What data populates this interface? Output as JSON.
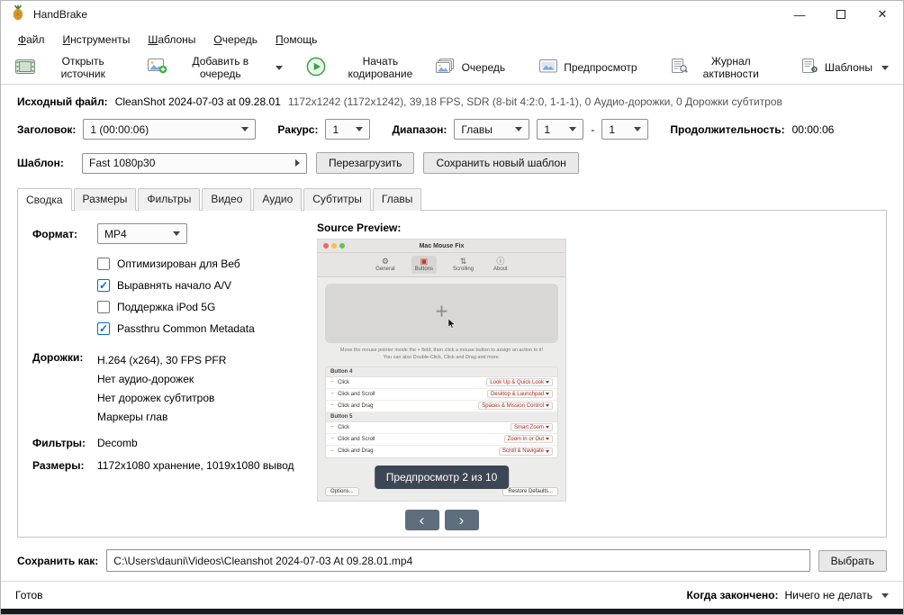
{
  "window": {
    "title": "HandBrake"
  },
  "menu": {
    "items": [
      {
        "label": "Файл"
      },
      {
        "label": "Инструменты"
      },
      {
        "label": "Шаблоны"
      },
      {
        "label": "Очередь"
      },
      {
        "label": "Помощь"
      }
    ]
  },
  "toolbar": {
    "open_source": "Открыть источник",
    "add_to_queue": "Добавить в очередь",
    "start_encoding": "Начать кодирование",
    "queue": "Очередь",
    "preview": "Предпросмотр",
    "activity_log": "Журнал активности",
    "presets": "Шаблоны"
  },
  "source": {
    "label": "Исходный файл:",
    "name": "CleanShot 2024-07-03 at 09.28.01",
    "details": "1172x1242 (1172x1242), 39,18 FPS, SDR (8-bit 4:2:0, 1-1-1), 0 Аудио-дорожки, 0 Дорожки субтитров"
  },
  "title_row": {
    "title_label": "Заголовок:",
    "title_value": "1 (00:00:06)",
    "angle_label": "Ракурс:",
    "angle_value": "1",
    "range_label": "Диапазон:",
    "range_value": "Главы",
    "range_from": "1",
    "range_sep": "-",
    "range_to": "1",
    "duration_label": "Продолжительность:",
    "duration_value": "00:00:06"
  },
  "preset_row": {
    "label": "Шаблон:",
    "value": "Fast 1080p30",
    "reload": "Перезагрузить",
    "save_new": "Сохранить новый шаблон"
  },
  "tabs": {
    "items": [
      {
        "label": "Сводка"
      },
      {
        "label": "Размеры"
      },
      {
        "label": "Фильтры"
      },
      {
        "label": "Видео"
      },
      {
        "label": "Аудио"
      },
      {
        "label": "Субтитры"
      },
      {
        "label": "Главы"
      }
    ]
  },
  "summary": {
    "format_label": "Формат:",
    "format_value": "MP4",
    "checkboxes": [
      {
        "label": "Оптимизирован для Веб",
        "checked": false
      },
      {
        "label": "Выравнять начало A/V",
        "checked": true
      },
      {
        "label": "Поддержка iPod 5G",
        "checked": false
      },
      {
        "label": "Passthru Common Metadata",
        "checked": true
      }
    ],
    "tracks_label": "Дорожки:",
    "tracks": [
      "H.264 (x264), 30 FPS PFR",
      "Нет аудио-дорожек",
      "Нет дорожек субтитров",
      "Маркеры глав"
    ],
    "filters_label": "Фильтры:",
    "filters_value": "Decomb",
    "dimensions_label": "Размеры:",
    "dimensions_value": "1172x1080 хранение, 1019x1080 вывод",
    "preview_label": "Source Preview:",
    "tooltip": "Предпросмотр 2 из 10",
    "nav_prev": "‹",
    "nav_next": "›"
  },
  "mac_preview": {
    "title": "Mac Mouse Fix",
    "tabs": [
      {
        "label": "General"
      },
      {
        "label": "Buttons"
      },
      {
        "label": "Scrolling"
      },
      {
        "label": "About"
      }
    ],
    "plus": "+",
    "hint1": "Move the mouse pointer inside the + field, then click a mouse button to assign an action to it!",
    "hint2": "You can also Double-Click, Click and Drag and more.",
    "sections": [
      {
        "header": "Button 4",
        "rows": [
          {
            "action": "Click",
            "value": "Look Up & Quick Look"
          },
          {
            "action": "Click and Scroll",
            "value": "Desktop & Launchpad"
          },
          {
            "action": "Click and Drag",
            "value": "Spaces & Mission Control"
          }
        ]
      },
      {
        "header": "Button 5",
        "rows": [
          {
            "action": "Click",
            "value": "Smart Zoom"
          },
          {
            "action": "Click and Scroll",
            "value": "Zoom In or Out"
          },
          {
            "action": "Click and Drag",
            "value": "Scroll & Navigate"
          }
        ]
      }
    ],
    "options_button": "Options...",
    "restore_button": "Restore Defaults..."
  },
  "save": {
    "label": "Сохранить как:",
    "path": "C:\\Users\\dauni\\Videos\\Cleanshot 2024-07-03 At 09.28.01.mp4",
    "browse": "Выбрать"
  },
  "status": {
    "ready": "Готов",
    "when_done_label": "Когда закончено:",
    "when_done_value": "Ничего не делать"
  }
}
